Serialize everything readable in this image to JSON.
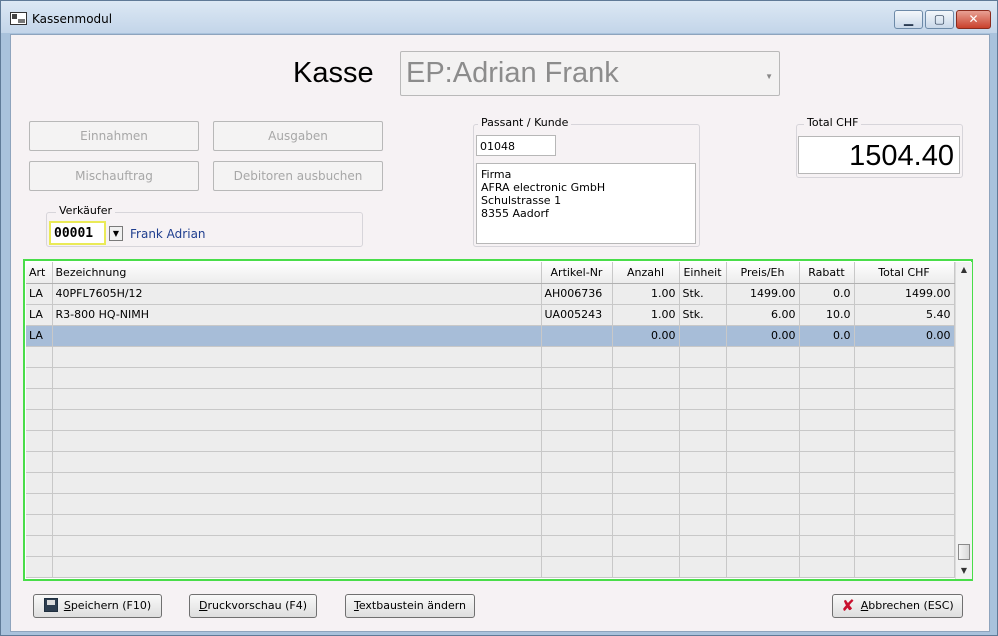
{
  "window": {
    "title": "Kassenmodul"
  },
  "header": {
    "kasse_label": "Kasse",
    "kasse_value": "EP:Adrian Frank"
  },
  "buttons": {
    "einnahmen": "Einnahmen",
    "ausgaben": "Ausgaben",
    "mischauftrag": "Mischauftrag",
    "debitoren": "Debitoren ausbuchen"
  },
  "verkaeufer": {
    "label": "Verkäufer",
    "code": "00001",
    "name": "Frank Adrian"
  },
  "kunde": {
    "label": "Passant / Kunde",
    "number": "01048",
    "address": [
      "Firma",
      "AFRA electronic GmbH",
      "Schulstrasse 1",
      "8355 Aadorf"
    ]
  },
  "total": {
    "label": "Total CHF",
    "value": "1504.40"
  },
  "grid": {
    "columns": [
      "Art",
      "Bezeichnung",
      "Artikel-Nr",
      "Anzahl",
      "Einheit",
      "Preis/Eh",
      "Rabatt",
      "Total CHF"
    ],
    "rows": [
      [
        "LA",
        "40PFL7605H/12",
        "AH006736",
        "1.00",
        "Stk.",
        "1499.00",
        "0.0",
        "1499.00"
      ],
      [
        "LA",
        "R3-800 HQ-NIMH",
        "UA005243",
        "1.00",
        "Stk.",
        "6.00",
        "10.0",
        "5.40"
      ],
      [
        "LA",
        "",
        "",
        "0.00",
        "",
        "0.00",
        "0.0",
        "0.00"
      ]
    ],
    "selected_row": 2,
    "empty_rows": 11
  },
  "footer": {
    "save_u": "S",
    "save_rest": "peichern (F10)",
    "preview_u": "D",
    "preview_rest": "ruckvorschau (F4)",
    "textbaustein_u": "T",
    "textbaustein_rest": "extbaustein ändern",
    "cancel_u": "A",
    "cancel_rest": "bbrechen (ESC)"
  },
  "colors": {
    "grid_border": "#49dd49",
    "selected_row": "#a7bdd8",
    "verkaeufer_border": "#eaea57"
  }
}
